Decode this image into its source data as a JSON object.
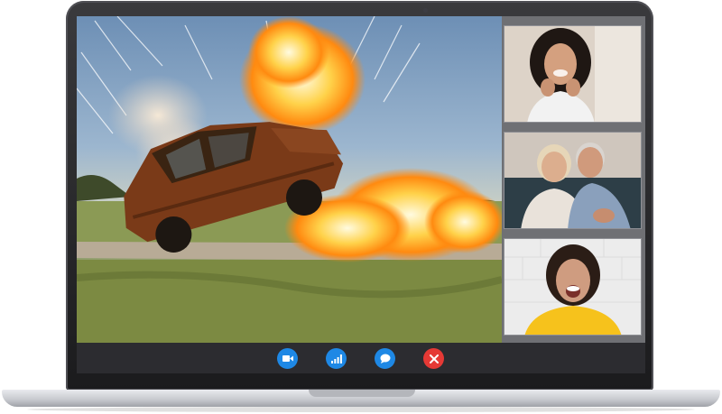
{
  "window": {
    "app": "video-call",
    "participants_count": 3
  },
  "colors": {
    "control_blue": "#1e88e5",
    "control_red": "#e53935",
    "control_bar": "#2c2c30",
    "screen_bg": "#6f7074"
  },
  "main_video": {
    "scene": "car-explosion"
  },
  "participants": [
    {
      "id": "participant-1",
      "shirt_color": "#f2f2f2"
    },
    {
      "id": "participant-2",
      "shirt_color": "#e9e2da"
    },
    {
      "id": "participant-3",
      "shirt_color": "#f6c21c"
    }
  ],
  "controls": [
    {
      "id": "camera",
      "icon": "video-camera-icon",
      "color": "#1e88e5"
    },
    {
      "id": "signal",
      "icon": "signal-bars-icon",
      "color": "#1e88e5"
    },
    {
      "id": "chat",
      "icon": "chat-bubble-icon",
      "color": "#1e88e5"
    },
    {
      "id": "end-call",
      "icon": "close-icon",
      "color": "#e53935"
    }
  ]
}
